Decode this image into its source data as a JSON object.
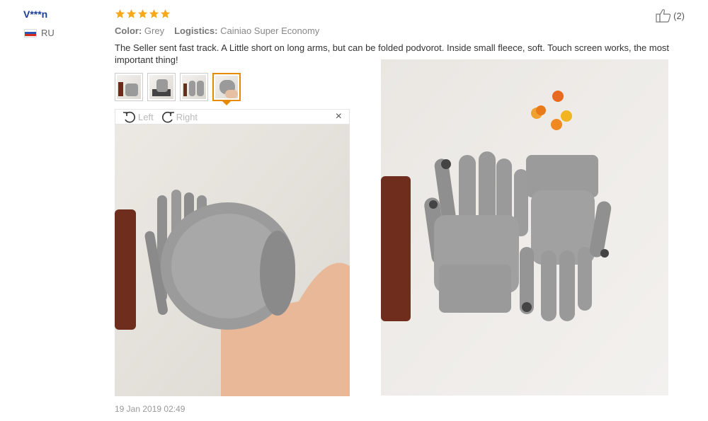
{
  "user": {
    "name": "V***n",
    "country": "RU"
  },
  "rating": {
    "stars": 5,
    "color": "#f5a623"
  },
  "helpful": {
    "count": "(2)",
    "icon": "thumbs-up-icon"
  },
  "meta": [
    {
      "key": "Color:",
      "value": "Grey"
    },
    {
      "key": "Logistics:",
      "value": "Cainiao Super Economy"
    }
  ],
  "review_text": "The Seller sent fast track. A Little short on long arms, but can be folded podvorot. Inside small fleece, soft. Touch screen works, the most important thing!",
  "thumbnails": {
    "count": 4,
    "active_index": 3
  },
  "viewer": {
    "rotate_left": "Left",
    "rotate_right": "Right",
    "close": "×"
  },
  "date": "19 Jan 2019 02:49",
  "colors": {
    "accent": "#e68a00",
    "username": "#1a3f96",
    "star": "#f5a623"
  }
}
